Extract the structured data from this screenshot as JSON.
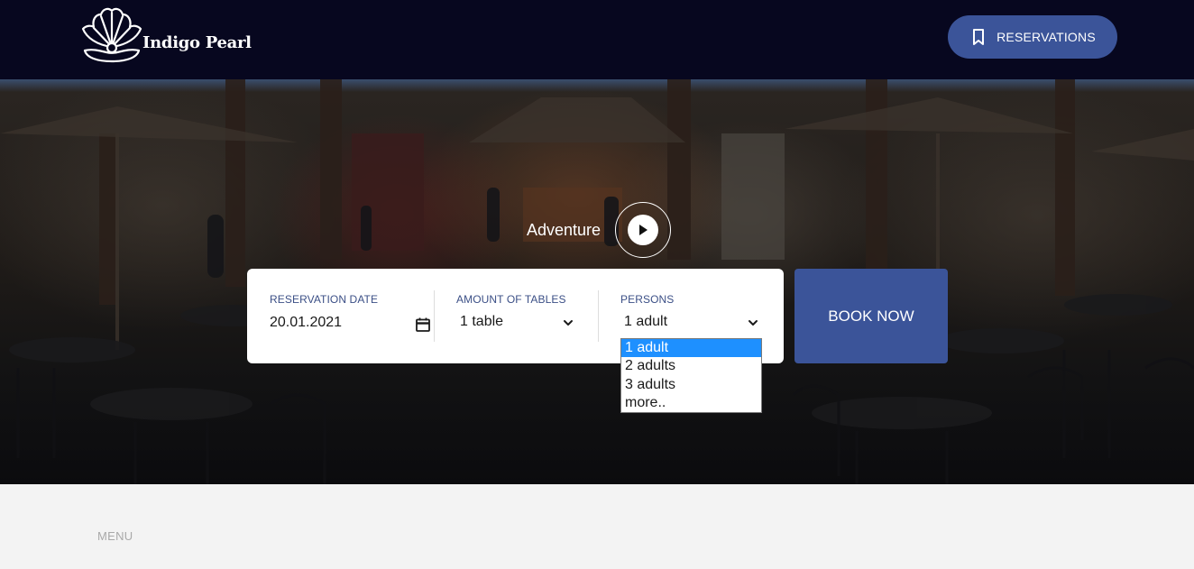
{
  "header": {
    "brand_name": "Indigo Pearl",
    "reservations_label": "RESERVATIONS"
  },
  "hero": {
    "video_label": "Adventure"
  },
  "booking": {
    "date_label": "RESERVATION DATE",
    "date_value": "20.01.2021",
    "tables_label": "AMOUNT OF TABLES",
    "tables_value": "1 table",
    "persons_label": "PERSONS",
    "persons_value": "1 adult",
    "book_label": "BOOK NOW"
  },
  "persons_dropdown": {
    "options": [
      "1 adult",
      "2 adults",
      "3 adults",
      "more.."
    ],
    "selected": "1 adult"
  },
  "lower": {
    "menu_label": "MENU"
  },
  "colors": {
    "header_bg": "#07071f",
    "accent": "#3b5499",
    "selected_option": "#1e90ff"
  }
}
